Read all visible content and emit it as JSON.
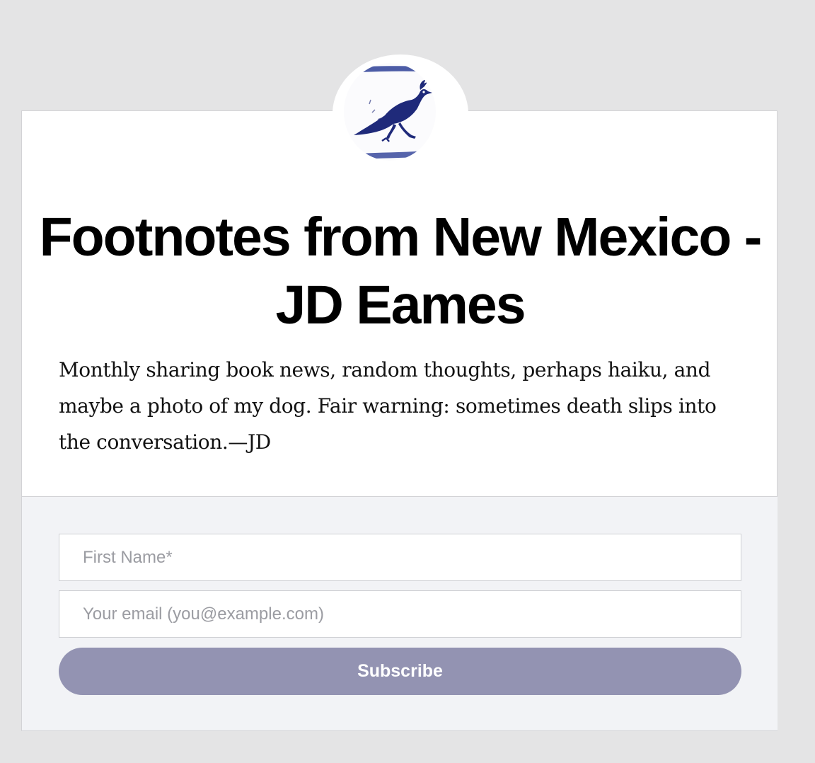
{
  "header": {
    "avatar_icon": "roadrunner-illustration"
  },
  "newsletter": {
    "title": "Footnotes from New Mexico - JD Eames",
    "description": "Monthly sharing book news, random thoughts, perhaps haiku, and maybe a photo of my dog. Fair warning: sometimes death slips into the conversation.—JD"
  },
  "form": {
    "first_name_placeholder": "First Name*",
    "first_name_value": "",
    "email_placeholder": "Your email (you@example.com)",
    "email_value": "",
    "subscribe_label": "Subscribe"
  },
  "colors": {
    "page_background": "#e4e4e5",
    "card_background": "#ffffff",
    "form_background": "#f2f3f6",
    "button_accent": "#9393b2",
    "illustration_blue": "#1f2a7a"
  }
}
